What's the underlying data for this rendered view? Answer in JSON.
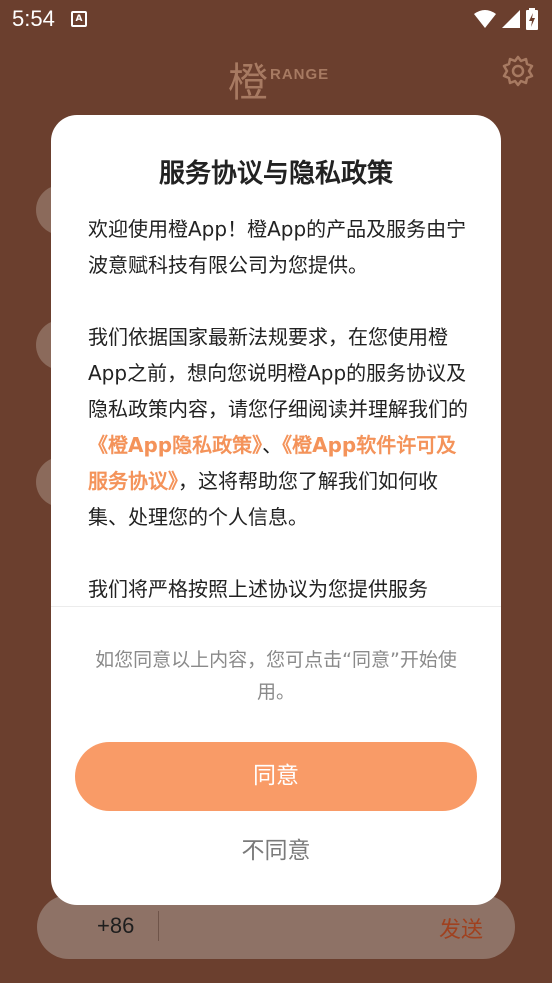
{
  "status_bar": {
    "time": "5:54",
    "notification_icon": "A"
  },
  "app": {
    "logo_char": "橙",
    "logo_text": "RANGE",
    "settings_icon": "gear-icon",
    "phone_prefix": "+86",
    "send_label": "发送"
  },
  "dialog": {
    "title": "服务协议与隐私政策",
    "para1": "欢迎使用橙App！橙App的产品及服务由宁波意赋科技有限公司为您提供。",
    "para2_part1": "我们依据国家最新法规要求，在您使用橙App之前，想向您说明橙App的服务协议及隐私政策内容，请您仔细阅读并理解我们的",
    "privacy_link": "《橙App隐私政策》",
    "para2_sep": "、",
    "service_link": "《橙App软件许可及服务协议》",
    "para2_part2": "，这将帮助您了解我们如何收集、处理您的个人信息。",
    "para3": "我们将严格按照上述协议为您提供服务",
    "note": "如您同意以上内容，您可点击“同意”开始使用。",
    "agree_label": "同意",
    "disagree_label": "不同意"
  },
  "colors": {
    "background": "#6b3f2e",
    "accent": "#f99b67",
    "link": "#f4935a"
  }
}
